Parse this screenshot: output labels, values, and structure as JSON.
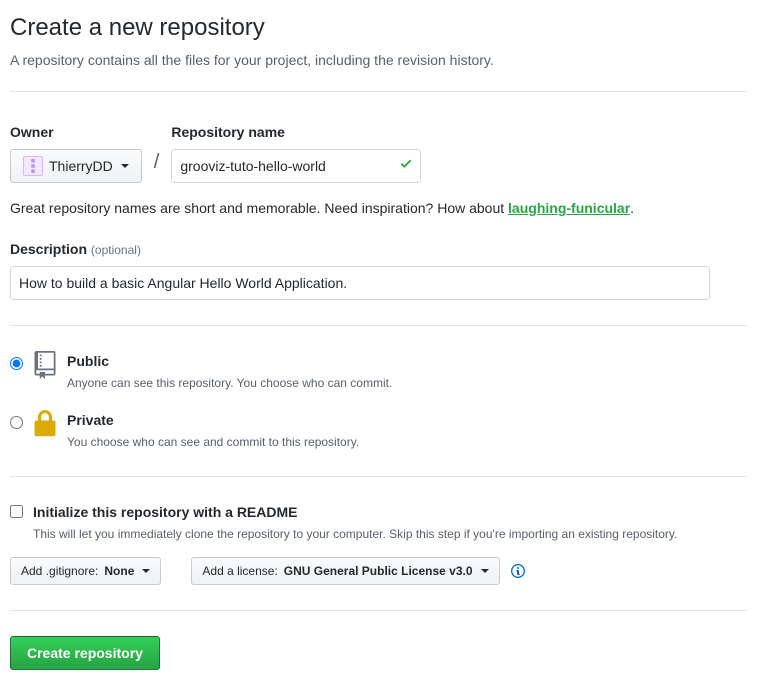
{
  "page": {
    "title": "Create a new repository",
    "subtitle": "A repository contains all the files for your project, including the revision history."
  },
  "owner": {
    "label": "Owner",
    "selected": "ThierryDD"
  },
  "repoName": {
    "label": "Repository name",
    "value": "grooviz-tuto-hello-world"
  },
  "hint": {
    "text": "Great repository names are short and memorable. Need inspiration? How about ",
    "suggestion": "laughing-funicular",
    "period": "."
  },
  "description": {
    "label": "Description ",
    "optional": "(optional)",
    "value": "How to build a basic Angular Hello World Application."
  },
  "visibility": {
    "public": {
      "title": "Public",
      "desc": "Anyone can see this repository. You choose who can commit."
    },
    "private": {
      "title": "Private",
      "desc": "You choose who can see and commit to this repository."
    }
  },
  "readme": {
    "title": "Initialize this repository with a README",
    "desc": "This will let you immediately clone the repository to your computer. Skip this step if you're importing an existing repository."
  },
  "gitignore": {
    "prefix": "Add .gitignore: ",
    "value": "None "
  },
  "license": {
    "prefix": "Add a license: ",
    "value": "GNU General Public License v3.0 "
  },
  "submit": "Create repository"
}
